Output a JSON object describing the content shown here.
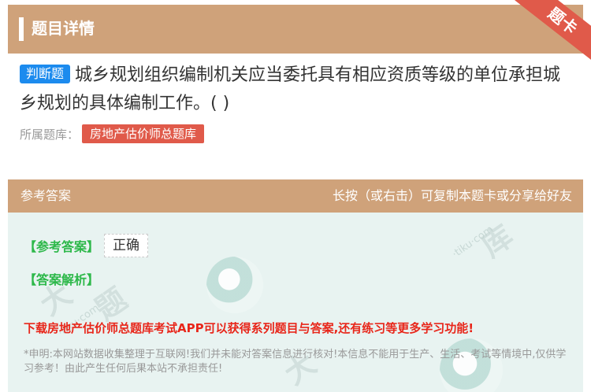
{
  "header": {
    "title": "题目详情",
    "corner_tag": "题卡"
  },
  "question": {
    "type_badge": "判断题",
    "text": "城乡规划组织编制机关应当委托具有相应资质等级的单位承担城乡规划的具体编制工作。( )"
  },
  "bank": {
    "label": "所属题库：",
    "name": "房地产估价师总题库"
  },
  "answer_section": {
    "title": "参考答案",
    "hint": "长按（或右击）可复制本题卡或分享给好友",
    "ref_label": "【参考答案】",
    "ref_value": "正确",
    "analysis_label": "【答案解析】",
    "promo": "下载房地产估价师总题库考试APP可以获得系列题目与答案,还有练习等更多学习功能!",
    "disclaimer": "*申明:本网站数据收集整理于互联网!我们并未能对答案信息进行核对!本信息不能用于生产、生活、考试等情境中,仅供学习参考！由此产生任何后果本站不承担责任!"
  },
  "colors": {
    "header_bg": "#cfa27a",
    "badge_blue": "#1c8bee",
    "tag_red": "#e05a4a",
    "answer_green": "#2db84a",
    "promo_red": "#e8261a"
  }
}
